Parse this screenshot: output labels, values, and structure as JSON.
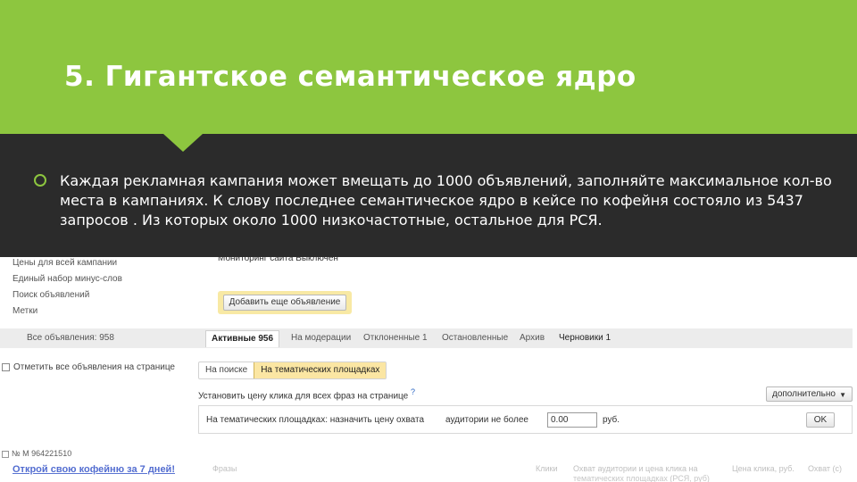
{
  "slide": {
    "title": "5. Гигантское семантическое ядро",
    "bullet_text": "Каждая рекламная кампания может вмещать до 1000 объявлений, заполняйте максимальное кол-во места в кампаниях. К слову последнее семантическое ядро в кейсе по кофейня состояло из 5437 запросов . Из которых около 1000 низкочастотные, остальное для РСЯ."
  },
  "colors": {
    "header_green": "#8dc63f",
    "overlay_dark": "#2b2b2b",
    "highlight_yellow": "#fbe6a3"
  },
  "screenshot": {
    "sidebar_links": [
      "Цены для всей кампании",
      "Единый набор минус-слов",
      "Поиск объявлений",
      "Метки"
    ],
    "top_row_text": "Мониторинг сайта   Выключен",
    "add_ad_button": "Добавить еще объявление",
    "all_ads": "Все объявления: 958",
    "tabs": [
      {
        "label": "Активные 956"
      },
      {
        "label": "На модерации"
      },
      {
        "label": "Отклоненные 1"
      },
      {
        "label": "Остановленные"
      },
      {
        "label": "Архив"
      },
      {
        "label": "Черновики 1"
      }
    ],
    "select_all": "Отметить все объявления на странице",
    "placement_tabs": [
      "На поиске",
      "На тематических площадках"
    ],
    "bid_text": "Установить цену клика для всех фраз на странице",
    "help_mark": "?",
    "extra_button": "дополнительно",
    "coverage": {
      "label": "На тематических площадках: назначить цену охвата",
      "label2": "аудитории не более",
      "value": "0.00",
      "currency": "руб.",
      "ok": "OK"
    },
    "ad_number": "№ M 964221510",
    "ad_title": "Открой свою кофейню за 7 дней!",
    "columns": [
      "Фразы",
      "Клики",
      "Охват аудитории и цена клика на тематических площадках (РСЯ, руб)",
      "Цена клика, руб.",
      "Охват (с)"
    ]
  }
}
